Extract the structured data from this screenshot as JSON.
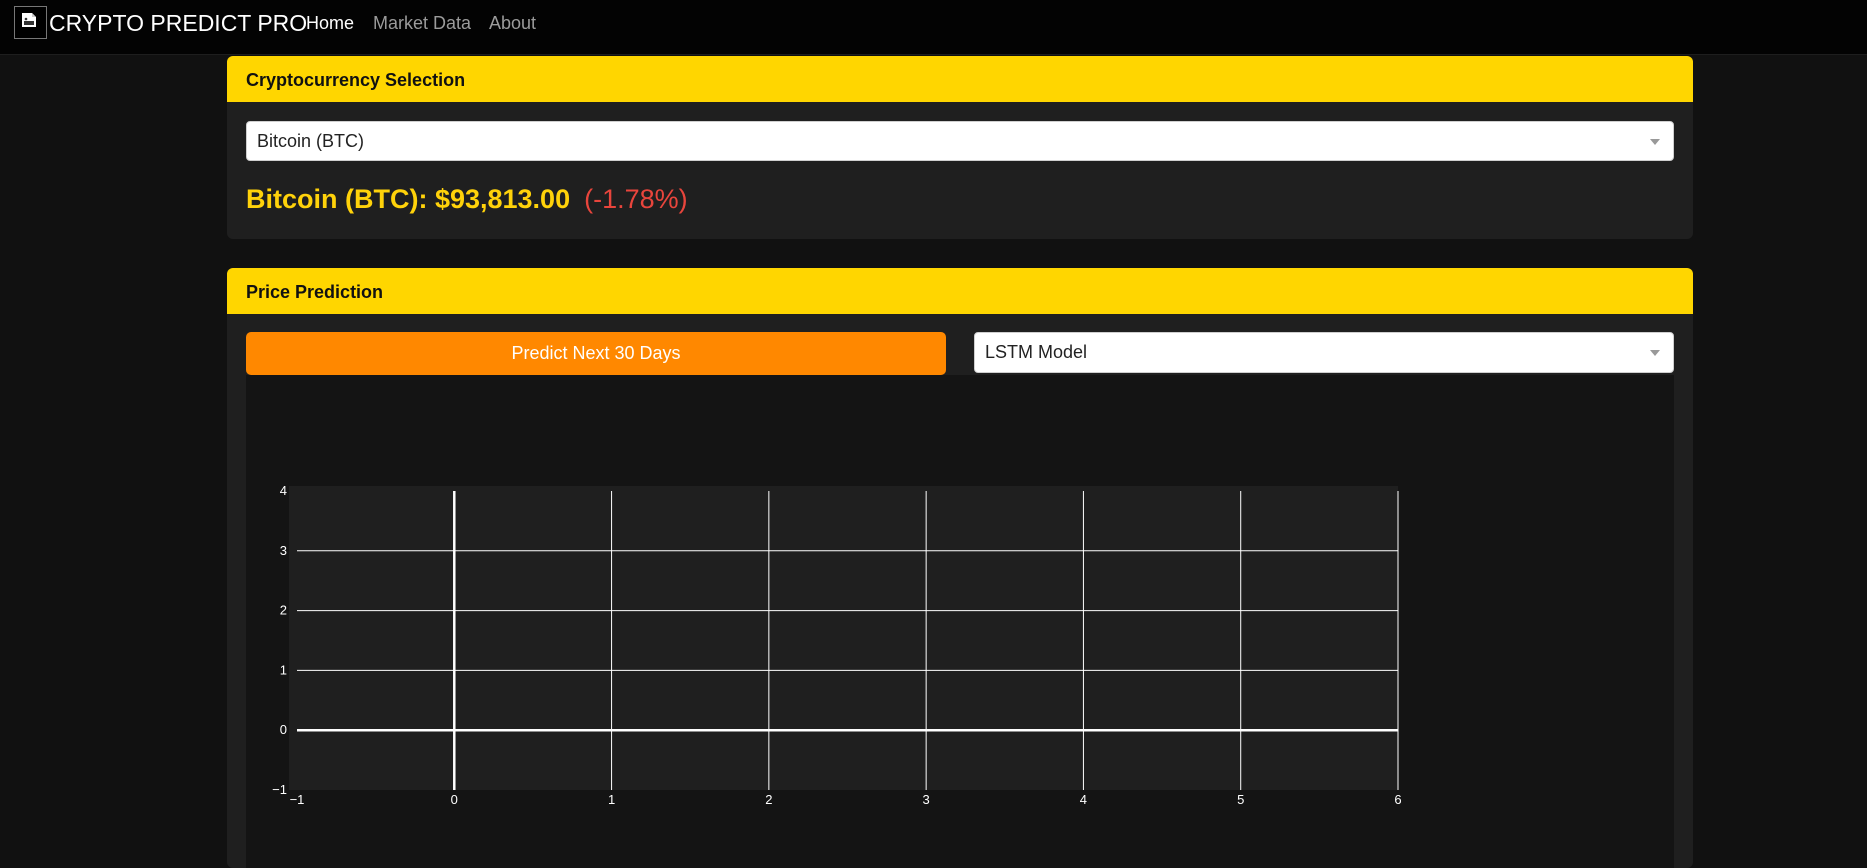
{
  "navbar": {
    "brand": "CRYPTO PREDICT PRO",
    "logo_icon": "broken-image-icon",
    "links": [
      {
        "label": "Home",
        "active": true
      },
      {
        "label": "Market Data",
        "active": false
      },
      {
        "label": "About",
        "active": false
      }
    ]
  },
  "crypto_card": {
    "title": "Cryptocurrency Selection",
    "selected": "Bitcoin (BTC)",
    "price_label": "Bitcoin (BTC): $93,813.00",
    "change_label": "(-1.78%)"
  },
  "prediction_card": {
    "title": "Price Prediction",
    "predict_button": "Predict Next 30 Days",
    "model_selected": "LSTM Model"
  },
  "colors": {
    "accent_yellow": "#ffd600",
    "button_orange": "#ff8800",
    "price_yellow": "#ffd20a",
    "negative_red": "#e8453c"
  },
  "chart_data": {
    "type": "scatter",
    "xlim": [
      -1,
      6
    ],
    "ylim": [
      -1,
      4
    ],
    "x_ticks": [
      "−1",
      "0",
      "1",
      "2",
      "3",
      "4",
      "5",
      "6"
    ],
    "y_ticks": [
      "−1",
      "0",
      "1",
      "2",
      "3",
      "4"
    ],
    "series": [],
    "grid": true
  }
}
